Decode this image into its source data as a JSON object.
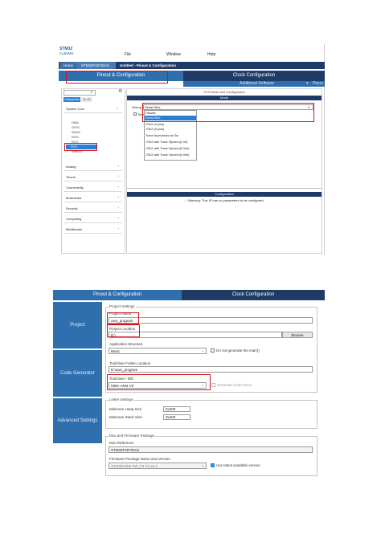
{
  "top": {
    "logo_line1": "STM32",
    "logo_line2": "CubeMX",
    "menu": [
      "File",
      "Window",
      "Help"
    ],
    "breadcrumbs": [
      "Home",
      "STM32F407IGHx",
      "Untitled - Pinout & Configuration"
    ],
    "tabs": [
      "Pinout & Configuration",
      "Clock Configuration"
    ],
    "subtabs": [
      "Additional Software",
      "Pinou"
    ],
    "search_placeholder": "",
    "sort_buttons": [
      "Categories",
      "A->Z"
    ],
    "categories": [
      {
        "label": "System Core",
        "expanded": true
      },
      {
        "label": "Analog"
      },
      {
        "label": "Timers"
      },
      {
        "label": "Connectivity"
      },
      {
        "label": "Multimedia"
      },
      {
        "label": "Security"
      },
      {
        "label": "Computing"
      },
      {
        "label": "Middleware"
      }
    ],
    "system_core_items": [
      "DMA",
      "GPIO",
      "IWDG",
      "NVIC",
      "RCC",
      "SYS",
      "WWDG"
    ],
    "selected_item": "SYS",
    "mode_panel_title": "SYS Mode and Configuration",
    "mode_header": "Mode",
    "debug_label": "Debug",
    "debug_value": "Serial Wire",
    "timebase_label": "Time",
    "debug_options": [
      "Disable",
      "Serial Wire",
      "JTAG (4 pins)",
      "JTAG (5 pins)",
      "Trace Asynchronous Sw",
      "JTAG with Trace Synchro(1 bit)",
      "JTAG with Trace Synchro(2 bits)",
      "JTAG with Trace Synchro(4 bits)"
    ],
    "config_header": "Configuration",
    "warning_text": "Warning: This IP has no parameters to be configured."
  },
  "bottom": {
    "tabs": [
      "Pinout & Configuration",
      "Clock Configuration"
    ],
    "side_sections": [
      "Project",
      "Code Generator",
      "Advanced Settings"
    ],
    "project_settings_title": "Project Settings",
    "project_name_label": "Project Name",
    "project_name_value": "uwo_program",
    "project_location_label": "Project Location",
    "project_location_value": "D:\\",
    "browse_button": "Browse",
    "app_structure_label": "Application Structure",
    "app_structure_value": "Basic",
    "no_main_label": "Do not generate the main()",
    "toolchain_folder_label": "Toolchain Folder Location",
    "toolchain_folder_value": "D:\\uwo_program",
    "toolchain_ide_label": "Toolchain / IDE",
    "toolchain_ide_value": "MDK-ARM V5",
    "generate_under_root_label": "Generate Under Root",
    "linker_title": "Linker Settings",
    "heap_label": "Minimum Heap Size",
    "heap_value": "0x200",
    "stack_label": "Minimum Stack Size",
    "stack_value": "0x400",
    "mcu_title": "Mcu and Firmware Package",
    "mcu_ref_label": "Mcu Reference",
    "mcu_ref_value": "STM32F407IGHx",
    "fw_label": "Firmware Package Name and Version",
    "fw_value": "STM32Cube FW_F4 V1.24.1",
    "use_latest_label": "Use latest available version"
  },
  "colors": {
    "dark_blue": "#1d3b66",
    "tab_blue": "#2f6fae",
    "highlight_red": "#d8121b",
    "selected_blue": "#2a7fd4"
  }
}
